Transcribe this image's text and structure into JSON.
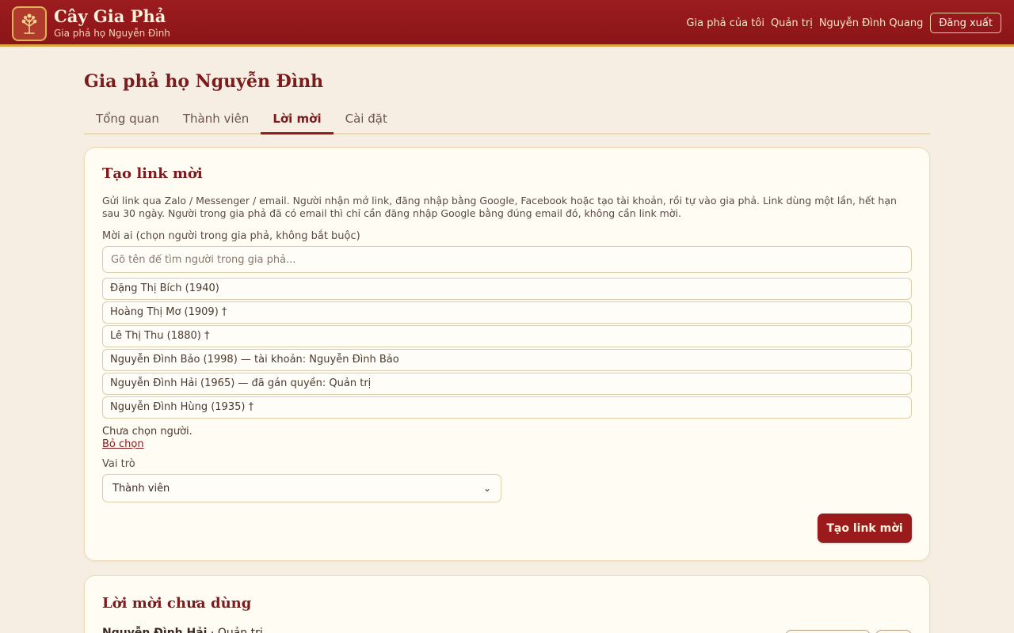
{
  "header": {
    "app_title": "Cây Gia Phả",
    "app_subtitle": "Gia phả họ Nguyễn Đình",
    "logo_icon": "family-tree-icon",
    "nav": {
      "my_trees": "Gia phả của tôi",
      "admin": "Quản trị",
      "user_name": "Nguyễn Đình Quang",
      "logout": "Đăng xuất"
    }
  },
  "page": {
    "title": "Gia phả họ Nguyễn Đình",
    "tabs": [
      {
        "label": "Tổng quan",
        "active": false
      },
      {
        "label": "Thành viên",
        "active": false
      },
      {
        "label": "Lời mời",
        "active": true
      },
      {
        "label": "Cài đặt",
        "active": false
      }
    ]
  },
  "invite": {
    "title": "Tạo link mời",
    "description": "Gửi link qua Zalo / Messenger / email. Người nhận mở link, đăng nhập bằng Google, Facebook hoặc tạo tài khoản, rồi tự vào gia phả. Link dùng một lần, hết hạn sau 30 ngày. Người trong gia phả đã có email thì chỉ cần đăng nhập Google bằng đúng email đó, không cần link mời.",
    "who_label": "Mời ai (chọn người trong gia phả, không bắt buộc)",
    "search_placeholder": "Gõ tên để tìm người trong gia phả...",
    "people": [
      "Đặng Thị Bích (1940)",
      "Hoàng Thị Mơ (1909) †",
      "Lê Thị Thu (1880) †",
      "Nguyễn Đình Bảo (1998) — tài khoản: Nguyễn Đình Bảo",
      "Nguyễn Đình Hải (1965) — đã gán quyền: Quản trị",
      "Nguyễn Đình Hùng (1935) †"
    ],
    "status": "Chưa chọn người.",
    "clear_label": "Bỏ chọn",
    "role_label": "Vai trò",
    "role_value": "Thành viên",
    "submit_label": "Tạo link mời"
  },
  "pending": {
    "title": "Lời mời chưa dùng",
    "first_name": "Nguyễn Đình Hải",
    "first_role": " · Quản trị"
  },
  "colors": {
    "brand": "#9b1b1d",
    "accent_gold": "#d9a441",
    "background": "#f6eee2",
    "card": "#fffcf4"
  }
}
